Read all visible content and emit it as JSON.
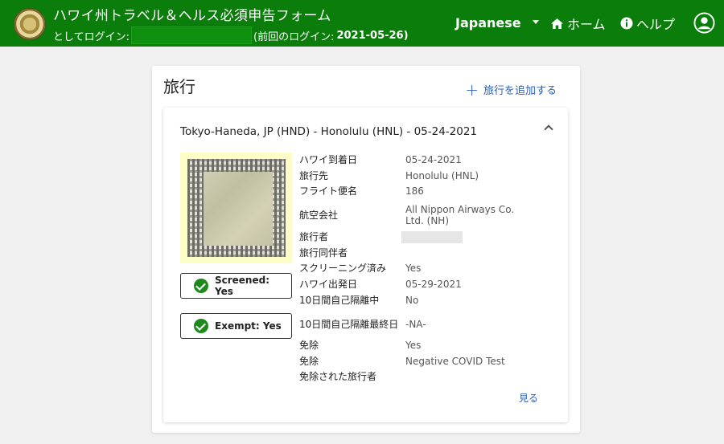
{
  "header": {
    "title": "ハワイ州トラベル＆ヘルス必須申告フォーム",
    "login_prefix": "としてログイン:",
    "last_login_prefix": "(前回のログイン:",
    "last_login_date": "2021-05-26)",
    "language": "Japanese",
    "home_label": "ホーム",
    "help_label": "ヘルプ"
  },
  "card": {
    "title": "旅行",
    "add_trip_label": "旅行を追加する"
  },
  "trip": {
    "route": "Tokyo-Haneda, JP (HND) - Honolulu (HNL) - 05-24-2021",
    "screened_label": "Screened: Yes",
    "exempt_label": "Exempt: Yes",
    "view_label": "見る",
    "details": [
      {
        "label": "ハワイ到着日",
        "value": "05-24-2021"
      },
      {
        "label": "旅行先",
        "value": "Honolulu (HNL)"
      },
      {
        "label": "フライト便名",
        "value": "186"
      },
      {
        "label": "航空会社",
        "value": "All Nippon Airways Co. Ltd. (NH)"
      },
      {
        "label": "旅行者",
        "value": ""
      },
      {
        "label": "旅行同伴者",
        "value": ""
      },
      {
        "label": "スクリーニング済み",
        "value": "Yes"
      },
      {
        "label": "ハワイ出発日",
        "value": "05-29-2021"
      },
      {
        "label": "10日間自己隔離中",
        "value": "No"
      },
      {
        "label": "10日間自己隔離最終日",
        "value": "-NA-"
      },
      {
        "label": "免除",
        "value": "Yes"
      },
      {
        "label": "免除",
        "value": "Negative COVID Test"
      },
      {
        "label": "免除された旅行者",
        "value": ""
      }
    ]
  },
  "colors": {
    "header_bg": "#0b7d0b",
    "link": "#2a5fb3",
    "check": "#1e8a1e"
  }
}
